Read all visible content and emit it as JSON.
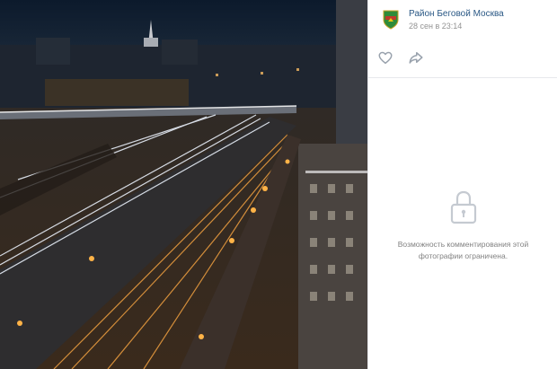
{
  "post": {
    "community_name": "Район Беговой Москва",
    "date": "28 сен в 23:14"
  },
  "actions": {
    "like_icon": "heart-icon",
    "share_icon": "share-arrow-icon"
  },
  "comments": {
    "restricted_line1": "Возможность комментирования этой",
    "restricted_line2": "фотографии ограничена.",
    "icon": "lock-icon"
  },
  "colors": {
    "link": "#2a5885",
    "muted": "#939393",
    "icon": "#99a2ad",
    "avatar_green": "#2e8b3a",
    "avatar_red": "#c0392b"
  }
}
